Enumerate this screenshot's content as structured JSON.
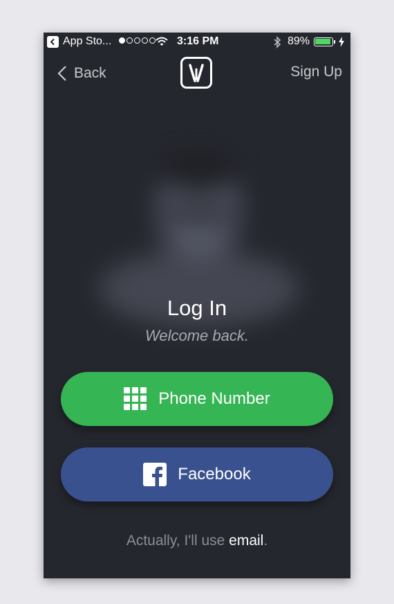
{
  "status_bar": {
    "back_app": "App Sto...",
    "time": "3:16 PM",
    "battery": "89%",
    "signal_bars_filled": 1,
    "signal_bars_total": 5,
    "battery_level": 0.89
  },
  "nav": {
    "back_label": "Back",
    "signup_label": "Sign Up"
  },
  "login": {
    "title": "Log In",
    "subtitle": "Welcome back."
  },
  "buttons": {
    "phone": "Phone Number",
    "facebook": "Facebook"
  },
  "alt_login": {
    "prefix": "Actually, I'll use ",
    "link": "email",
    "suffix": "."
  },
  "colors": {
    "background": "#25272e",
    "phone_button": "#35b554",
    "facebook_button": "#3a5190",
    "battery_fill": "#4cd964"
  },
  "icons": [
    "back-app-icon",
    "wifi-icon",
    "bluetooth-icon",
    "battery-icon",
    "charging-icon",
    "chevron-left-icon",
    "jiosaavn-logo-icon",
    "keypad-icon",
    "facebook-icon"
  ]
}
